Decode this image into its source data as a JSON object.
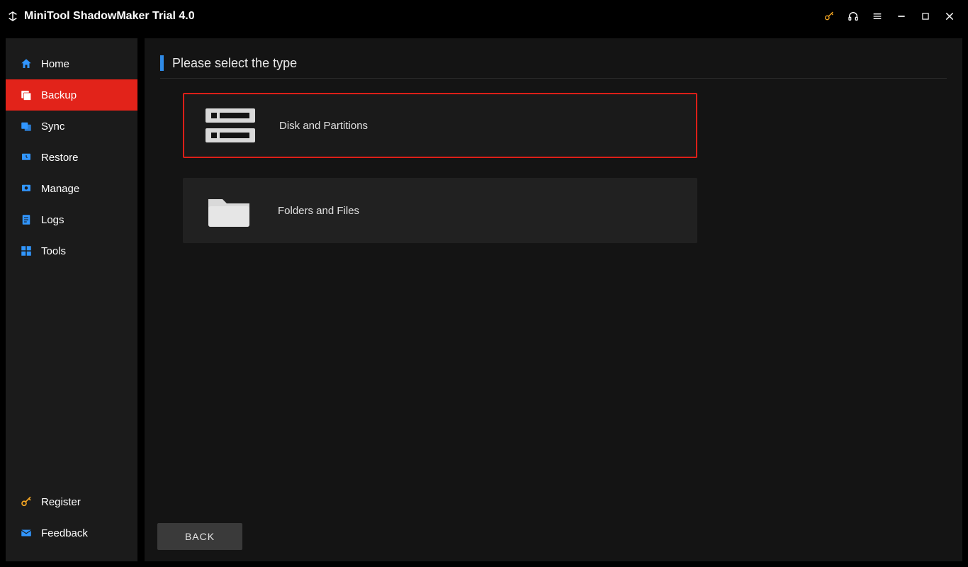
{
  "app": {
    "title": "MiniTool ShadowMaker Trial 4.0"
  },
  "sidebar": {
    "items": [
      {
        "label": "Home",
        "icon": "home"
      },
      {
        "label": "Backup",
        "icon": "backup",
        "active": true
      },
      {
        "label": "Sync",
        "icon": "sync"
      },
      {
        "label": "Restore",
        "icon": "restore"
      },
      {
        "label": "Manage",
        "icon": "manage"
      },
      {
        "label": "Logs",
        "icon": "logs"
      },
      {
        "label": "Tools",
        "icon": "tools"
      }
    ],
    "bottom": [
      {
        "label": "Register",
        "icon": "key"
      },
      {
        "label": "Feedback",
        "icon": "mail"
      }
    ]
  },
  "page": {
    "header": "Please select the type",
    "options": [
      {
        "label": "Disk and Partitions",
        "selected": true
      },
      {
        "label": "Folders and Files",
        "selected": false
      }
    ],
    "back": "BACK"
  }
}
